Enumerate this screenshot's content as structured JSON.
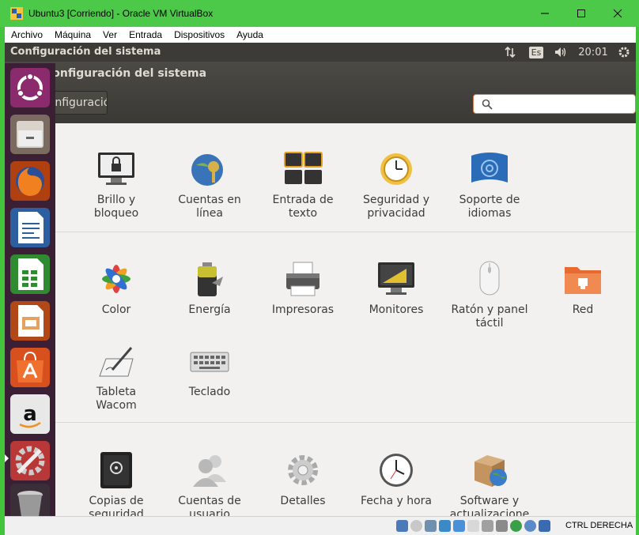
{
  "window": {
    "title": "Ubuntu3 [Corriendo] - Oracle VM VirtualBox"
  },
  "menubar": [
    "Archivo",
    "Máquina",
    "Ver",
    "Entrada",
    "Dispositivos",
    "Ayuda"
  ],
  "panel": {
    "title": "Configuración del sistema",
    "keyboard": "Es",
    "time": "20:01"
  },
  "header": {
    "title": "Configuración del sistema",
    "back_label": "Configuración",
    "search_placeholder": ""
  },
  "sections": [
    {
      "items": [
        {
          "label": "Brillo y\nbloqueo",
          "icon": "lock-monitor-icon"
        },
        {
          "label": "Cuentas en\nlínea",
          "icon": "online-accounts-icon"
        },
        {
          "label": "Entrada de\ntexto",
          "icon": "keyboard-input-icon"
        },
        {
          "label": "Seguridad y\nprivacidad",
          "icon": "privacy-clock-icon"
        },
        {
          "label": "Soporte de\nidiomas",
          "icon": "language-flag-icon"
        }
      ]
    },
    {
      "items": [
        {
          "label": "Color",
          "icon": "color-icon"
        },
        {
          "label": "Energía",
          "icon": "battery-icon"
        },
        {
          "label": "Impresoras",
          "icon": "printer-icon"
        },
        {
          "label": "Monitores",
          "icon": "monitor-icon"
        },
        {
          "label": "Ratón y panel\ntáctil",
          "icon": "mouse-icon"
        },
        {
          "label": "Red",
          "icon": "network-folder-icon"
        },
        {
          "label": "Tableta\nWacom",
          "icon": "wacom-tablet-icon"
        },
        {
          "label": "Teclado",
          "icon": "keyboard-icon"
        }
      ]
    },
    {
      "items": [
        {
          "label": "Copias de\nseguridad",
          "icon": "safe-icon"
        },
        {
          "label": "Cuentas de\nusuario",
          "icon": "users-icon"
        },
        {
          "label": "Detalles",
          "icon": "gear-icon"
        },
        {
          "label": "Fecha y hora",
          "icon": "clock-icon"
        },
        {
          "label": "Software y\nactualizacione",
          "icon": "software-box-icon"
        }
      ]
    }
  ],
  "launcher": [
    "ubuntu-dash-icon",
    "files-icon",
    "firefox-icon",
    "writer-icon",
    "calc-icon",
    "impress-icon",
    "software-center-icon",
    "amazon-icon",
    "settings-icon",
    "trash-icon"
  ],
  "statusbar": {
    "host_key": "CTRL DERECHA"
  }
}
